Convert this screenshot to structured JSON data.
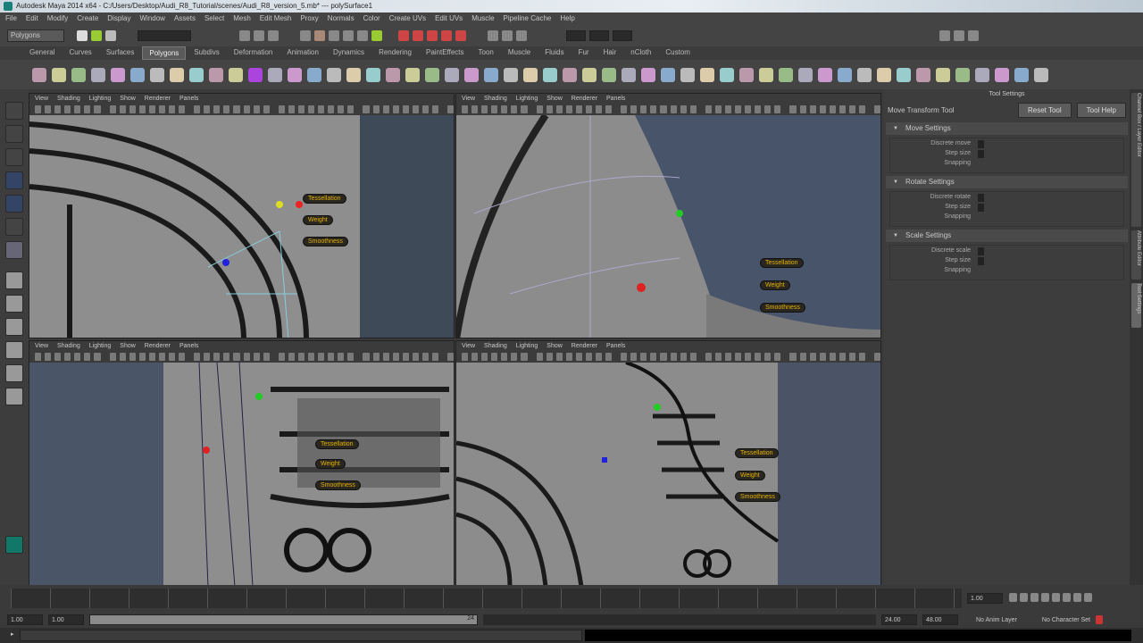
{
  "window": {
    "title": "Autodesk Maya 2014 x64 - C:/Users/Desktop/Audi_R8_Tutorial/scenes/Audi_R8_version_5.mb* --- polySurface1"
  },
  "menubar": [
    "File",
    "Edit",
    "Modify",
    "Create",
    "Display",
    "Window",
    "Assets",
    "Select",
    "Mesh",
    "Edit Mesh",
    "Proxy",
    "Normals",
    "Color",
    "Create UVs",
    "Edit UVs",
    "Muscle",
    "Pipeline Cache",
    "Help"
  ],
  "statusline": {
    "mode": "Polygons"
  },
  "shelf_tabs": [
    "General",
    "Curves",
    "Surfaces",
    "Polygons",
    "Subdivs",
    "Deformation",
    "Animation",
    "Dynamics",
    "Rendering",
    "PaintEffects",
    "Toon",
    "Muscle",
    "Fluids",
    "Fur",
    "Hair",
    "nCloth",
    "Custom"
  ],
  "active_shelf_tab": "Polygons",
  "viewport_menu": [
    "View",
    "Shading",
    "Lighting",
    "Show",
    "Renderer",
    "Panels"
  ],
  "hud": {
    "a": "Tessellation",
    "b": "Weight",
    "c": "Smoothness"
  },
  "tool_settings": {
    "title": "Tool Settings",
    "tool": "Move Transform Tool",
    "reset": "Reset Tool",
    "help": "Tool Help",
    "sections": [
      {
        "name": "Move Settings",
        "rows": [
          "Discrete move",
          "Step size",
          "Snapping"
        ]
      },
      {
        "name": "Rotate Settings",
        "rows": [
          "Discrete rotate",
          "Step size",
          "Snapping"
        ]
      },
      {
        "name": "Scale Settings",
        "rows": [
          "Discrete scale",
          "Step size",
          "Snapping"
        ]
      }
    ]
  },
  "side_tabs": [
    "Channel Box / Layer Editor",
    "Attribute Editor",
    "Tool Settings"
  ],
  "timeline": {
    "current": "1.00",
    "range_start": "1.00",
    "range_inner_start": "1.00",
    "range_inner_end": "24",
    "range_end": "24.00",
    "end": "48.00",
    "anim_layer": "No Anim Layer",
    "character_set": "No Character Set"
  },
  "colors": {
    "bg": "#3a3a3a",
    "viewport_grey": "#8c8c8c",
    "hud_text": "#e6b400"
  }
}
